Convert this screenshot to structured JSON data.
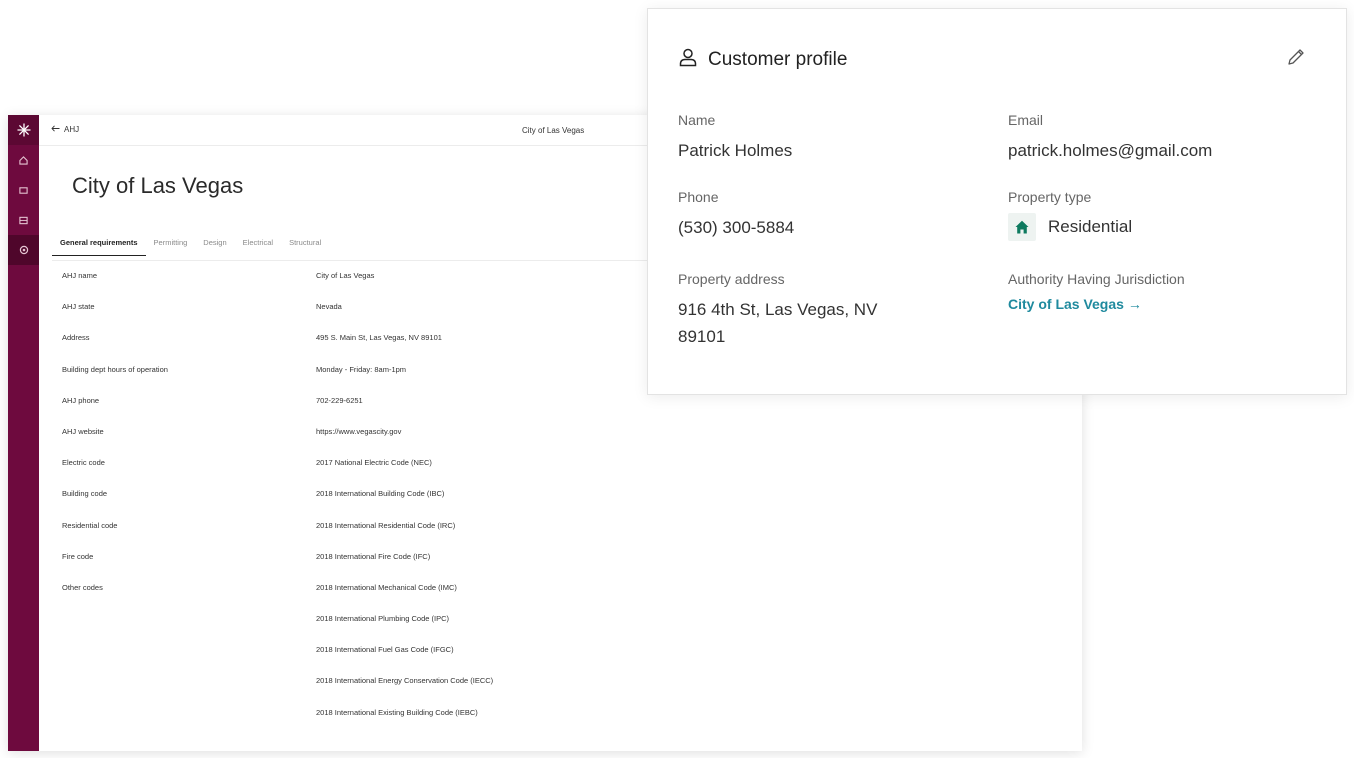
{
  "app": {
    "back_label": "AHJ",
    "topbar_title": "City of Las Vegas",
    "page_title": "City of Las Vegas",
    "tabs": [
      {
        "label": "General requirements",
        "active": true
      },
      {
        "label": "Permitting",
        "active": false
      },
      {
        "label": "Design",
        "active": false
      },
      {
        "label": "Electrical",
        "active": false
      },
      {
        "label": "Structural",
        "active": false
      }
    ],
    "rows": [
      {
        "label": "AHJ name",
        "value": "City of Las Vegas"
      },
      {
        "label": "AHJ state",
        "value": "Nevada"
      },
      {
        "label": "Address",
        "value": "495 S. Main St, Las Vegas, NV 89101"
      },
      {
        "label": "Building dept hours of operation",
        "value": "Monday - Friday: 8am-1pm"
      },
      {
        "label": "AHJ phone",
        "value": "702-229-6251"
      },
      {
        "label": "AHJ website",
        "value": "https://www.vegascity.gov"
      },
      {
        "label": "Electric code",
        "value": "2017 National Electric Code (NEC)"
      },
      {
        "label": "Building code",
        "value": "2018 International Building Code (IBC)"
      },
      {
        "label": "Residential code",
        "value": "2018 International Residential Code (IRC)"
      },
      {
        "label": "Fire code",
        "value": "2018 International Fire Code (IFC)"
      },
      {
        "label": "Other codes",
        "value": "2018 International Mechanical Code (IMC)"
      },
      {
        "label": "",
        "value": "2018 International Plumbing Code (IPC)"
      },
      {
        "label": "",
        "value": "2018 International Fuel Gas Code (IFGC)"
      },
      {
        "label": "",
        "value": "2018 International Energy Conservation Code (IECC)"
      },
      {
        "label": "",
        "value": "2018 International Existing Building Code (IEBC)"
      }
    ],
    "rail_color": "#6e0a3e"
  },
  "profile": {
    "title": "Customer profile",
    "name_label": "Name",
    "name_value": "Patrick Holmes",
    "email_label": "Email",
    "email_value": "patrick.holmes@gmail.com",
    "phone_label": "Phone",
    "phone_value": "(530) 300-5884",
    "property_type_label": "Property type",
    "property_type_value": "Residential",
    "address_label": "Property address",
    "address_value": "916 4th St, Las Vegas, NV 89101",
    "ahj_label": "Authority Having Jurisdiction",
    "ahj_value": "City of Las Vegas →",
    "link_color": "#1f8a9e",
    "home_icon_color": "#0e7a5f"
  }
}
